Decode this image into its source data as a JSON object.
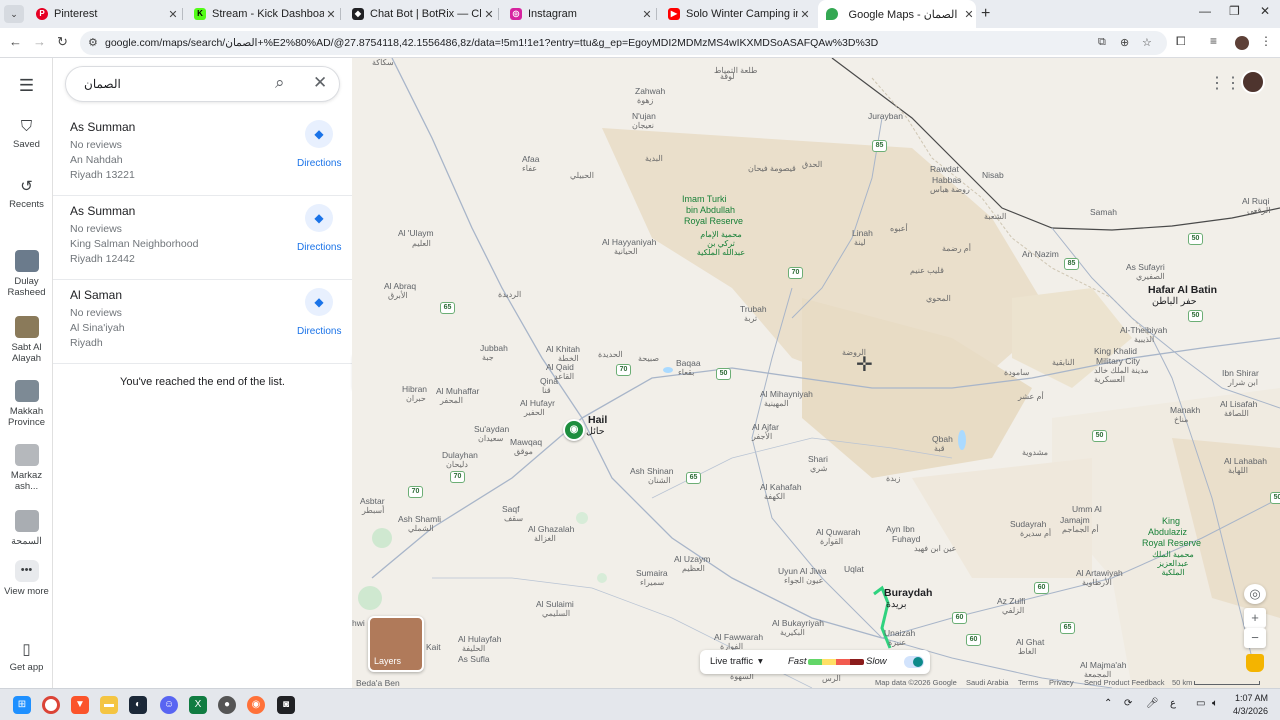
{
  "browser": {
    "tabs": [
      {
        "title": "Pinterest",
        "favicon": "pinterest-icon",
        "color": "#e60023",
        "active": false
      },
      {
        "title": "Stream - Kick Dashboard",
        "favicon": "kick-icon",
        "color": "#53fc18",
        "active": false
      },
      {
        "title": "Chat Bot | BotRix — Cloud Strea",
        "favicon": "botrix-icon",
        "color": "#202124",
        "active": false
      },
      {
        "title": "Instagram",
        "favicon": "instagram-icon",
        "color": "#d6249f",
        "active": false
      },
      {
        "title": "Solo Winter Camping in my Su",
        "favicon": "youtube-icon",
        "color": "#ff0000",
        "active": false
      },
      {
        "title": "Google Maps - الصمان",
        "favicon": "maps-icon",
        "color": "#34a853",
        "active": true
      }
    ],
    "url": "google.com/maps/search/الصمان+%E2%80%AD/@27.8754118,42.1556486,8z/data=!5m1!1e1?entry=ttu&g_ep=EgoyMDI2MDMzMS4wIKXMDSoASAFQAw%3D%3D"
  },
  "rail": {
    "menu_label": "Menu",
    "saved": "Saved",
    "recents": "Recents",
    "places": [
      {
        "label": "Dulay Rasheed",
        "color": "#6b7b8c"
      },
      {
        "label": "Sabt Al Alayah",
        "color": "#8a7a5a"
      },
      {
        "label": "Makkah Province",
        "color": "#7d8a95"
      },
      {
        "label": "Markaz ash...",
        "color": "#b5b8bc"
      },
      {
        "label": "السمحة",
        "color": "#a9adb2"
      }
    ],
    "view_more": "View more",
    "get_app": "Get app"
  },
  "search": {
    "query": "الصمان"
  },
  "results": [
    {
      "name": "As Summan",
      "reviews": "No reviews",
      "area": "An Nahdah",
      "city": "Riyadh 13221",
      "action": "Directions"
    },
    {
      "name": "As Summan",
      "reviews": "No reviews",
      "area": "King Salman Neighborhood",
      "city": "Riyadh 12442",
      "action": "Directions"
    },
    {
      "name": "Al Saman",
      "reviews": "No reviews",
      "area": "Al Sina'iyah",
      "city": "Riyadh",
      "action": "Directions"
    }
  ],
  "end_of_list": "You've reached the end of the list.",
  "map": {
    "labels": {
      "zahwah": "Zahwah",
      "zahwah_ar": "زهوة",
      "nujan": "N'ujan",
      "nujan_ar": "نعيجان",
      "afaa": "Afaa",
      "afaa_ar": "عفاء",
      "badiah": "البدية",
      "hubayli": "الحبيلي",
      "qusumah": "قيصومة فيحان",
      "haddaq": "الحدق",
      "jurayban": "Jurayban",
      "rawdat": "Rawdat",
      "habbas": "Habbas",
      "habbas_ar": "روضة هباس",
      "nisab": "Nisab",
      "samah": "Samah",
      "ruqi": "Al Ruqi",
      "ruqi_ar": "الرقعي",
      "imam1": "Imam Turki",
      "imam2": "bin Abdullah",
      "imam3": "Royal Reserve",
      "imam_ar": "محمية الإمام تركي بن عبدالله الملكية",
      "ulaym": "Al 'Ulaym",
      "ulaym_ar": "العليم",
      "hayyaniyah": "Al Hayyaniyah",
      "hayyaniyah_ar": "الحيانية",
      "linah": "Linah",
      "linah_ar": "لينة",
      "ubayh": "أعبوه",
      "umrimah": "أم رضمة",
      "shuabah": "الشعبة",
      "annazim": "An Nazim",
      "sufayri": "As Sufayri",
      "sufayri_ar": "الصفيري",
      "hafar": "Hafar Al Batin",
      "hafar_ar": "حفر الباطن",
      "abraq": "Al Abraq",
      "abraq_ar": "الأبرق",
      "rudaydah": "الرديدة",
      "qalib": "قليب عنيم",
      "mahwi": "المحوي",
      "trubah": "Trubah",
      "trubah_ar": "تربة",
      "theibiyah": "Al-Theibiyah",
      "theibiyah_ar": "الذيبية",
      "kkmc1": "King Khalid",
      "kkmc2": "Military City",
      "kkmc_ar": "مدينة الملك خالد العسكرية",
      "jubbah": "Jubbah",
      "jubbah_ar": "جبة",
      "khitah": "Al Khitah",
      "khitah_ar": "الخطة",
      "hadidah": "الحديدة",
      "sumayrah": "صبيحة",
      "baqaa": "Baqaa",
      "baqaa_ar": "بقعاء",
      "rawdah": "الروضة",
      "nabqiyah": "النابقية",
      "samudah": "سامودة",
      "ibnshirar": "Ibn Shirar",
      "ibnshirar_ar": "ابن شرار",
      "qaid": "Al Qaid",
      "qaid_ar": "القاعد",
      "qina": "Qina",
      "qina_ar": "قنا",
      "hibran": "Hibran",
      "hibran_ar": "حبران",
      "muhaffar": "Al Muhaffar",
      "muhaffar_ar": "المحفر",
      "hufayr": "Al Hufayr",
      "hufayr_ar": "الحفير",
      "mihayniyah": "Al Mihayniyah",
      "mihayniyah_ar": "المهينية",
      "umashar": "أم عشر",
      "manakh": "Manakh",
      "manakh_ar": "مناخ",
      "lisafah": "Al Lisafah",
      "lisafah_ar": "اللصافة",
      "hail": "Hail",
      "hail_ar": "حائل",
      "suaydan": "Su'aydan",
      "suaydan_ar": "سعيدان",
      "mawqaq": "Mawqaq",
      "mawqaq_ar": "موقق",
      "ajfar": "Al Ajfar",
      "ajfar_ar": "الأجفر",
      "qbah": "Qbah",
      "qbah_ar": "قبة",
      "mushdowiyah": "مشدوية",
      "dulayhan": "Dulayhan",
      "dulayhan_ar": "دليحان",
      "shinan": "Ash Shinan",
      "shinan_ar": "الشنان",
      "sharii": "Shari",
      "sharii_ar": "شري",
      "zaydah": "زبدة",
      "lahabah": "Al Lahabah",
      "lahabah_ar": "اللهابة",
      "asbtar": "Asbtar",
      "asbtar_ar": "أسبطر",
      "shamli": "Ash Shamli",
      "shamli_ar": "الشملي",
      "saqf": "Saqf",
      "saqf_ar": "سقف",
      "kahafah": "Al Kahafah",
      "kahafah_ar": "الكهفة",
      "ghazalah": "Al Ghazalah",
      "ghazalah_ar": "الغزالة",
      "quwarah": "Al Quwarah",
      "quwarah_ar": "القوارة",
      "aynibn": "Ayn Ibn",
      "fuhayd": "Fuhayd",
      "fuhayd_ar": "عين ابن فهيد",
      "sudayrah": "Sudayrah",
      "sudayrah_ar": "أم سديرة",
      "jamajm": "Umm Al",
      "jamajm2": "Jamajm",
      "jamajm_ar": "أم الجماجم",
      "kingab1": "King",
      "kingab2": "Abdulaziz",
      "kingab3": "Royal Reserve",
      "kingab_ar": "محمية الملك عبدالعزيز الملكية",
      "uzaym": "Al Uzaym",
      "uzaym_ar": "العظيم",
      "sumaira": "Sumaira",
      "sumaira_ar": "سميراء",
      "uyun": "Uyun Al Jiwa",
      "uyun_ar": "عيون الجواء",
      "uthal": "Uqlat",
      "buraydah": "Buraydah",
      "buraydah_ar": "بريدة",
      "artawiyah": "Al Artawiyah",
      "artawiyah_ar": "الأرطاوية",
      "zulfi": "Az Zulfi",
      "zulfi_ar": "الزلفي",
      "sulaimi": "Al Sulaimi",
      "sulaimi_ar": "السليمي",
      "bukayriyah": "Al Bukayriyah",
      "bukayriyah_ar": "البكيرية",
      "unaizah": "Unaizah",
      "unaizah_ar": "عنيزة",
      "hulayfah": "Al Hulayfah",
      "hulayfah_ar": "الحليفة",
      "sufla": "As Sufla",
      "fawwarah": "Al Fawwarah",
      "fawwarah_ar": "الفوارة",
      "ghat": "Al Ghat",
      "ghat_ar": "الغاط",
      "majmaah": "Al Majma'ah",
      "majmaah_ar": "المجمعة",
      "hwi": "hwi",
      "bedaben": "Beda'a Ben",
      "kait": "Kait",
      "rass": "الرس",
      "sahwah": "السهوة",
      "taliah": "طلعة التمياط",
      "lughah": "لوقة",
      "sakakah": "سكاكة"
    },
    "roads": [
      "65",
      "70",
      "70",
      "50",
      "85",
      "65",
      "70",
      "70",
      "65",
      "50",
      "65",
      "70",
      "65",
      "50",
      "65",
      "60",
      "60",
      "50",
      "60",
      "50",
      "85"
    ],
    "layers": "Layers",
    "live_traffic": "Live traffic",
    "fast": "Fast",
    "slow": "Slow",
    "footer": {
      "data": "Map data ©2026 Google",
      "country": "Saudi Arabia",
      "terms": "Terms",
      "privacy": "Privacy",
      "feedback": "Send Product Feedback",
      "scale": "50 km"
    }
  },
  "taskbar": {
    "time": "1:07 AM",
    "date": "4/3/2026",
    "lang": "ع"
  }
}
